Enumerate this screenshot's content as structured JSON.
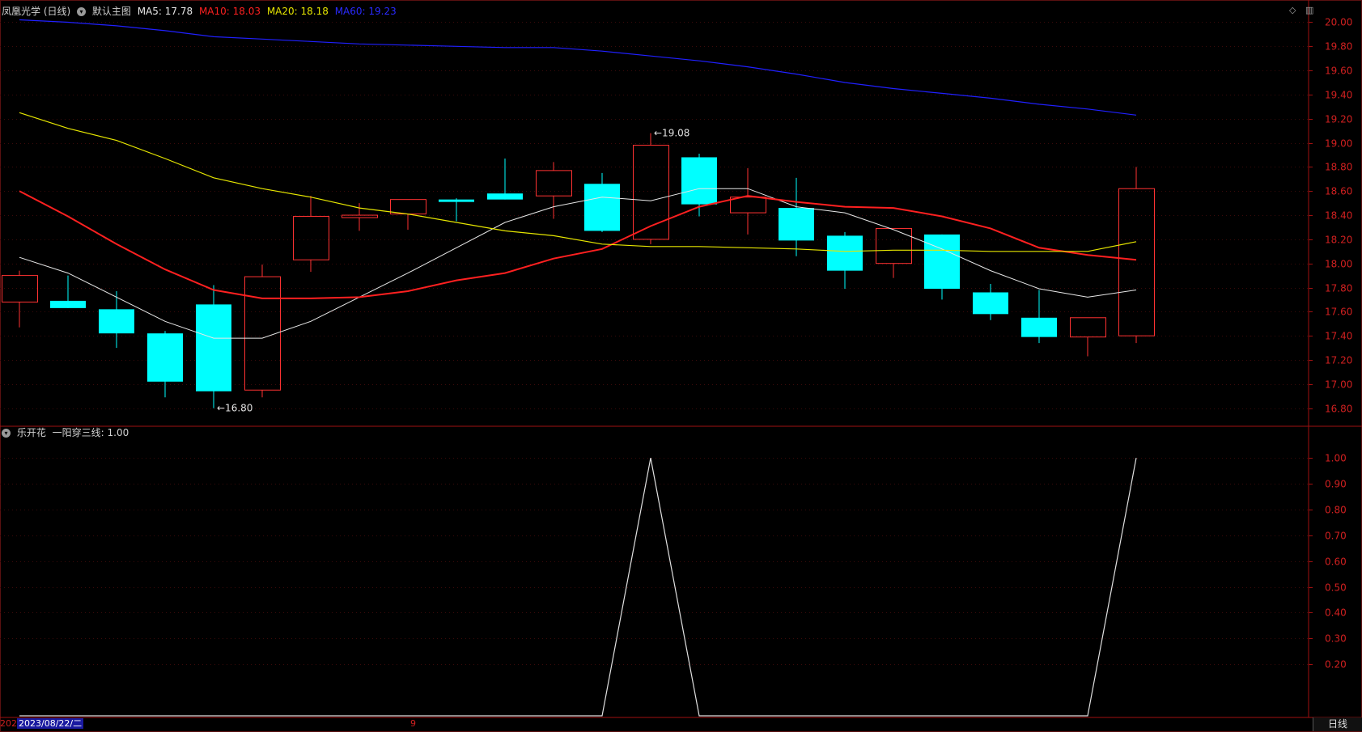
{
  "header": {
    "stock_label": "凤凰光学 (日线)",
    "template_label": "默认主图",
    "ma5": "MA5: 17.78",
    "ma10": "MA10: 18.03",
    "ma20": "MA20: 18.18",
    "ma60": "MA60: 19.23"
  },
  "sub_header": {
    "indicator_label": "乐开花",
    "value_label": "一阳穿三线: 1.00"
  },
  "bottom": {
    "date_prefix": "202",
    "date_highlight": "2023/08/22/二",
    "marker": "9",
    "period_tab": "日线"
  },
  "colors": {
    "up": "#ff3232",
    "down": "#00ffff",
    "ma5": "#e8e8e8",
    "ma10": "#ff2020",
    "ma20": "#e6e600",
    "ma60": "#2020ff",
    "frame": "#a01010",
    "axis_text": "#d02020",
    "indicator": "#e0e0e0"
  },
  "chart_data": [
    {
      "type": "candlestick",
      "ylim": [
        16.65,
        20.05
      ],
      "y_ticks": [
        "20.00",
        "19.80",
        "19.60",
        "19.40",
        "19.20",
        "19.00",
        "18.80",
        "18.60",
        "18.40",
        "18.20",
        "18.00",
        "17.80",
        "17.60",
        "17.40",
        "17.20",
        "17.00",
        "16.80"
      ],
      "candles": [
        {
          "o": 17.68,
          "h": 17.94,
          "l": 17.47,
          "c": 17.9
        },
        {
          "o": 17.69,
          "h": 17.9,
          "l": 17.63,
          "c": 17.63
        },
        {
          "o": 17.62,
          "h": 17.77,
          "l": 17.3,
          "c": 17.42
        },
        {
          "o": 17.42,
          "h": 17.44,
          "l": 16.89,
          "c": 17.02
        },
        {
          "o": 17.66,
          "h": 17.82,
          "l": 16.8,
          "c": 16.94
        },
        {
          "o": 16.95,
          "h": 17.99,
          "l": 16.89,
          "c": 17.89
        },
        {
          "o": 18.03,
          "h": 18.56,
          "l": 17.93,
          "c": 18.39
        },
        {
          "o": 18.38,
          "h": 18.5,
          "l": 18.27,
          "c": 18.4
        },
        {
          "o": 18.41,
          "h": 18.53,
          "l": 18.28,
          "c": 18.53
        },
        {
          "o": 18.53,
          "h": 18.54,
          "l": 18.35,
          "c": 18.51
        },
        {
          "o": 18.58,
          "h": 18.87,
          "l": 18.53,
          "c": 18.53
        },
        {
          "o": 18.56,
          "h": 18.84,
          "l": 18.37,
          "c": 18.77
        },
        {
          "o": 18.66,
          "h": 18.75,
          "l": 18.26,
          "c": 18.27
        },
        {
          "o": 18.2,
          "h": 19.08,
          "l": 18.16,
          "c": 18.98
        },
        {
          "o": 18.88,
          "h": 18.91,
          "l": 18.39,
          "c": 18.49
        },
        {
          "o": 18.42,
          "h": 18.79,
          "l": 18.24,
          "c": 18.55
        },
        {
          "o": 18.46,
          "h": 18.71,
          "l": 18.06,
          "c": 18.19
        },
        {
          "o": 18.23,
          "h": 18.26,
          "l": 17.79,
          "c": 17.94
        },
        {
          "o": 18.0,
          "h": 18.29,
          "l": 17.88,
          "c": 18.29
        },
        {
          "o": 18.24,
          "h": 18.24,
          "l": 17.7,
          "c": 17.79
        },
        {
          "o": 17.76,
          "h": 17.83,
          "l": 17.53,
          "c": 17.58
        },
        {
          "o": 17.55,
          "h": 17.78,
          "l": 17.34,
          "c": 17.39
        },
        {
          "o": 17.39,
          "h": 17.55,
          "l": 17.23,
          "c": 17.55
        },
        {
          "o": 17.4,
          "h": 18.8,
          "l": 17.34,
          "c": 18.62
        }
      ],
      "series": [
        {
          "name": "MA5",
          "values": [
            18.05,
            17.92,
            17.72,
            17.52,
            17.38,
            17.38,
            17.52,
            17.72,
            17.92,
            18.13,
            18.34,
            18.47,
            18.55,
            18.52,
            18.62,
            18.62,
            18.47,
            18.42,
            18.28,
            18.12,
            17.94,
            17.79,
            17.72,
            17.78
          ]
        },
        {
          "name": "MA10",
          "values": [
            18.6,
            18.39,
            18.16,
            17.95,
            17.78,
            17.71,
            17.71,
            17.72,
            17.77,
            17.86,
            17.92,
            18.04,
            18.12,
            18.31,
            18.47,
            18.56,
            18.51,
            18.47,
            18.46,
            18.39,
            18.29,
            18.13,
            18.07,
            18.03
          ]
        },
        {
          "name": "MA20",
          "values": [
            19.25,
            19.12,
            19.02,
            18.87,
            18.71,
            18.62,
            18.55,
            18.46,
            18.41,
            18.34,
            18.27,
            18.23,
            18.16,
            18.14,
            18.14,
            18.13,
            18.12,
            18.1,
            18.11,
            18.11,
            18.1,
            18.1,
            18.1,
            18.18
          ]
        },
        {
          "name": "MA60",
          "values": [
            20.02,
            20.0,
            19.97,
            19.93,
            19.88,
            19.86,
            19.84,
            19.82,
            19.81,
            19.8,
            19.79,
            19.79,
            19.76,
            19.72,
            19.68,
            19.63,
            19.57,
            19.5,
            19.45,
            19.41,
            19.37,
            19.32,
            19.28,
            19.23
          ]
        }
      ],
      "annotations": [
        {
          "label": "19.08",
          "candle": 13,
          "value": 19.08
        },
        {
          "label": "16.80",
          "candle": 4,
          "value": 16.8
        }
      ]
    },
    {
      "type": "line",
      "ylim": [
        0.0,
        1.06
      ],
      "y_ticks": [
        "1.00",
        "0.90",
        "0.80",
        "0.70",
        "0.60",
        "0.50",
        "0.40",
        "0.30",
        "0.20"
      ],
      "series": [
        {
          "name": "一阳穿三线",
          "values": [
            0,
            0,
            0,
            0,
            0,
            0,
            0,
            0,
            0,
            0,
            0,
            0,
            0,
            1,
            0,
            0,
            0,
            0,
            0,
            0,
            0,
            0,
            0,
            1
          ]
        }
      ]
    }
  ]
}
